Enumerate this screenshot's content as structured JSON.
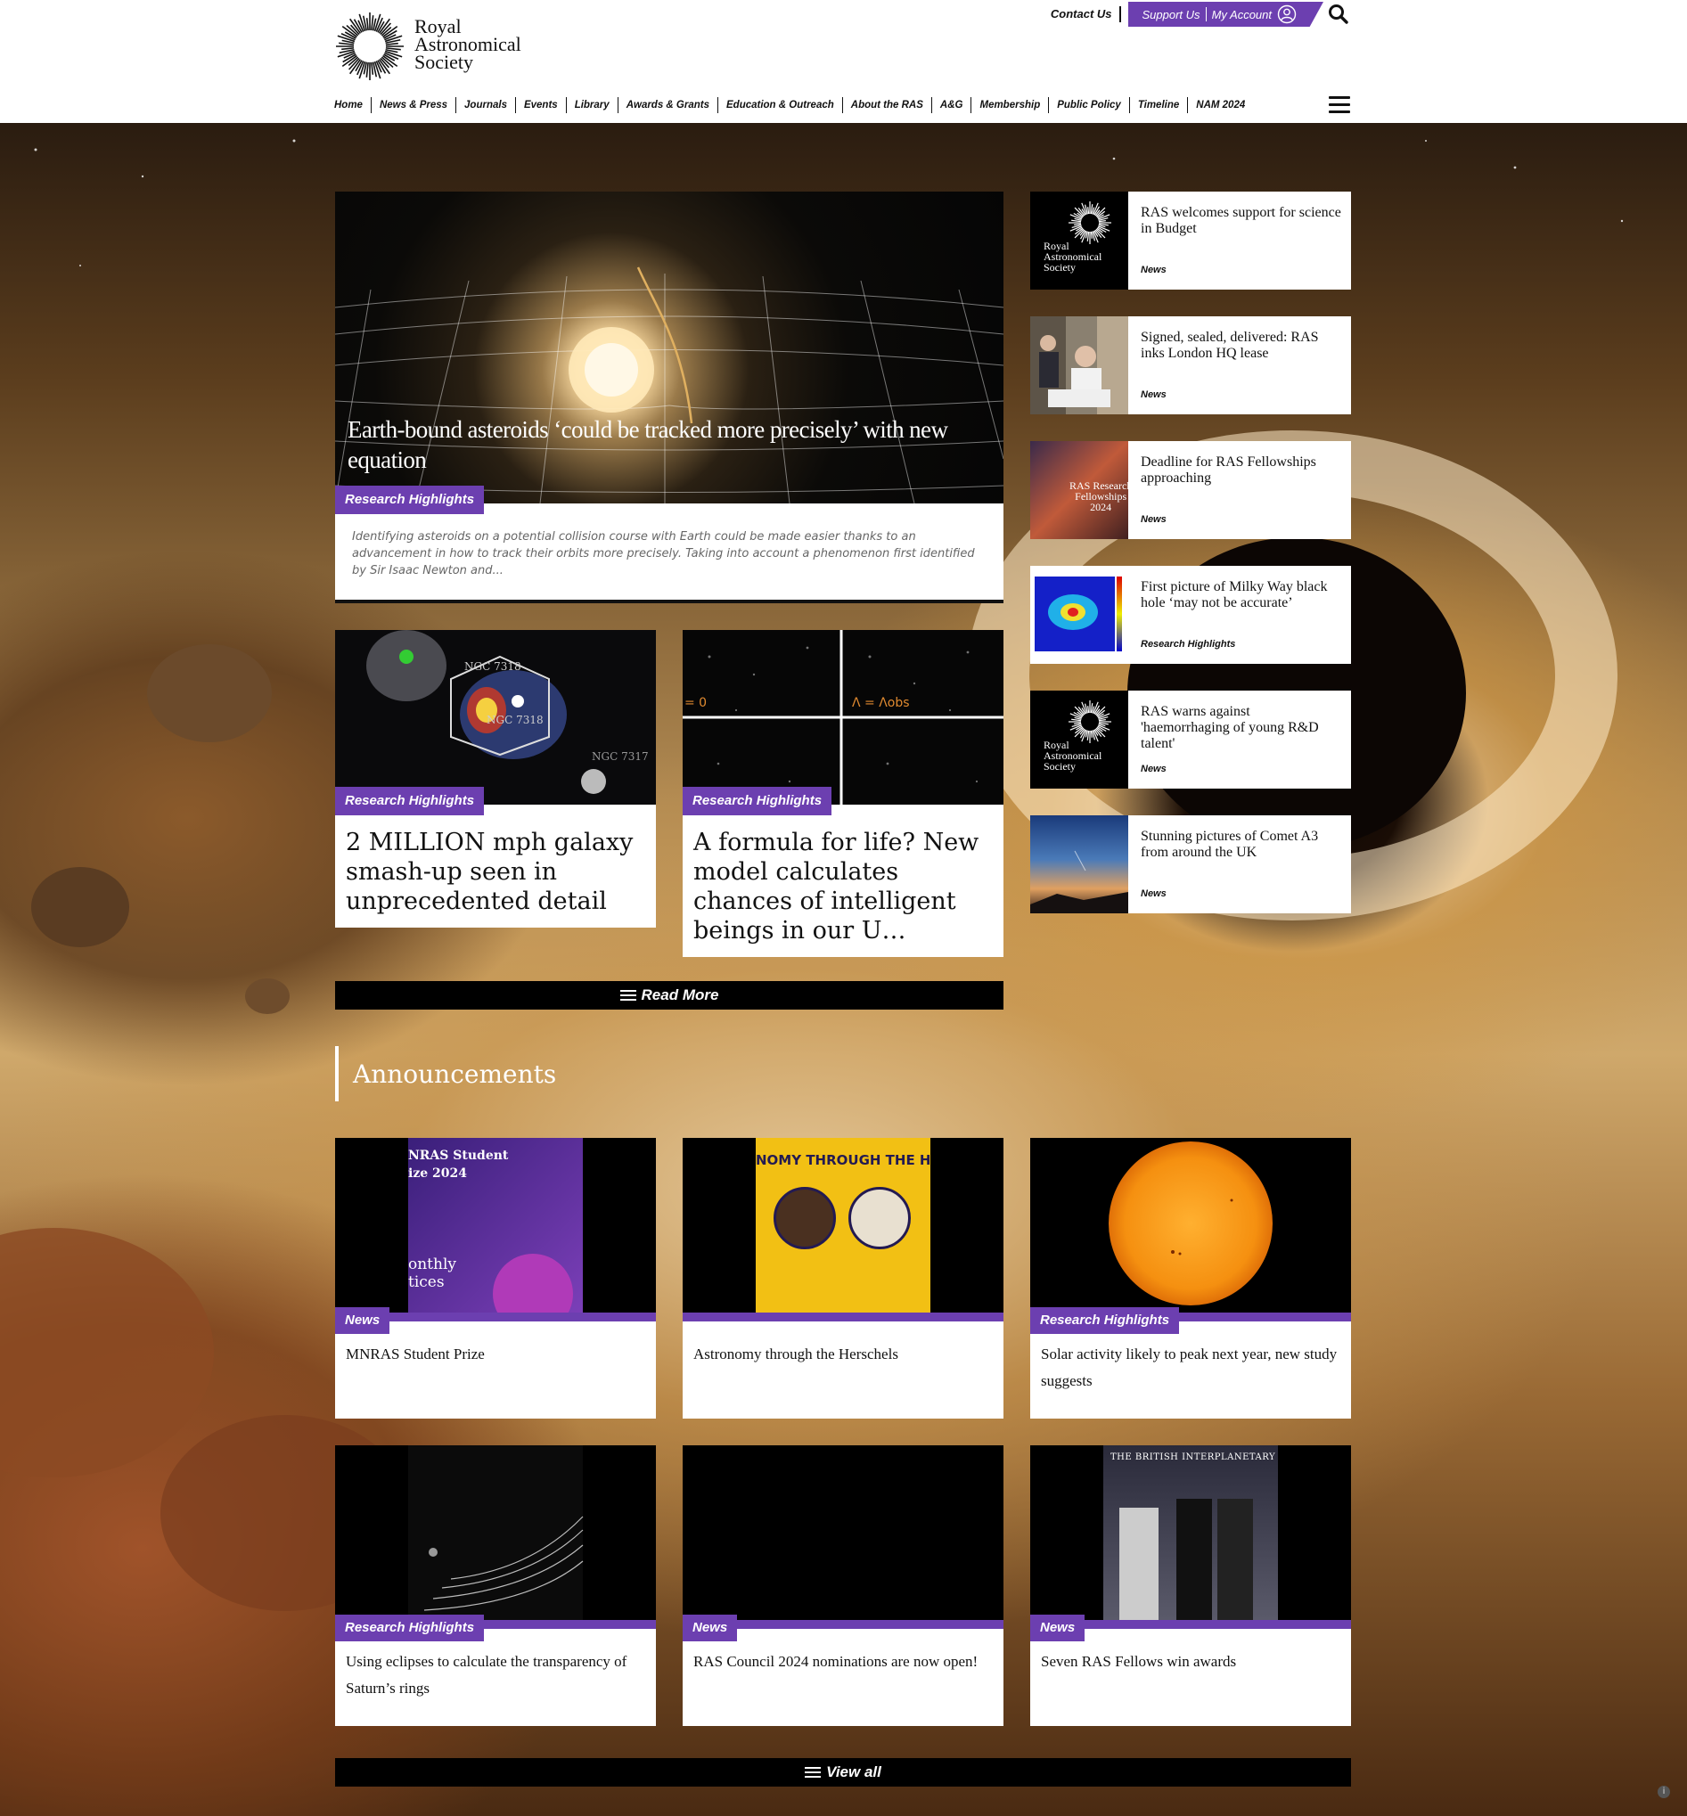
{
  "brand": {
    "logo_text": "Royal\nAstronomical\nSociety",
    "purple": "#6c3fb0"
  },
  "top_links": {
    "contact": "Contact Us",
    "support": "Support Us",
    "account": "My Account",
    "account_icon": "user-circle-icon",
    "search_icon": "search-icon"
  },
  "nav": [
    "Home",
    "News & Press",
    "Journals",
    "Events",
    "Library",
    "Awards & Grants",
    "Education & Outreach",
    "About the RAS",
    "A&G",
    "Membership",
    "Public Policy",
    "Timeline",
    "NAM 2024"
  ],
  "featured": {
    "title": "Earth-bound asteroids ‘could be tracked more precisely’ with new equation",
    "tag": "Research Highlights",
    "description": "Identifying asteroids on a potential collision course with Earth could be made easier thanks to an advancement in how to track their orbits more precisely. Taking into account a phenomenon first identified by Sir Isaac Newton and..."
  },
  "mid_cards": [
    {
      "tag": "Research Highlights",
      "title": "2 MILLION mph galaxy smash-up seen in unprecedented detail",
      "labels": [
        "NGC 7318",
        "NGC 7318",
        "NGC 7317"
      ]
    },
    {
      "tag": "Research Highlights",
      "title": "A formula for life? New model calculates chances of intelligent beings in our U…",
      "labels": [
        "= 0",
        "Λ = Λobs"
      ]
    }
  ],
  "read_more": "Read More",
  "side_items": [
    {
      "title": "RAS welcomes support for science in Budget",
      "category": "News"
    },
    {
      "title": "Signed, sealed, delivered: RAS inks London HQ lease",
      "category": "News"
    },
    {
      "title": "Deadline for RAS Fellowships approaching",
      "category": "News",
      "thumb_text": "RAS Research\nFellowships\n2024"
    },
    {
      "title": "First picture of Milky Way black hole ‘may not be accurate’",
      "category": "Research Highlights"
    },
    {
      "title": "RAS warns against 'haemorrhaging of young R&D talent'",
      "category": "News"
    },
    {
      "title": "Stunning pictures of Comet A3 from around the UK",
      "category": "News"
    }
  ],
  "mini_logo_text": "Royal\nAstronomical\nSociety",
  "announcements": {
    "heading": "Announcements",
    "cards": [
      {
        "tag": "News",
        "title": "MNRAS Student Prize",
        "poster_text": "NRAS Student\nize 2024",
        "poster_sub": "onthly\ntices"
      },
      {
        "tag": "",
        "title": "Astronomy through the Herschels",
        "poster_text": "NOMY THROUGH THE HER"
      },
      {
        "tag": "Research Highlights",
        "title": "Solar activity likely to peak next year, new study suggests"
      },
      {
        "tag": "Research Highlights",
        "title": "Using eclipses to calculate the transparency of Saturn’s rings"
      },
      {
        "tag": "News",
        "title": "RAS Council 2024 nominations are now open!"
      },
      {
        "tag": "News",
        "title": "Seven RAS Fellows win awards",
        "poster_text": "THE BRITISH INTERPLANETARY SOCIETY"
      }
    ]
  },
  "view_all": "View all",
  "info_icon": "i"
}
